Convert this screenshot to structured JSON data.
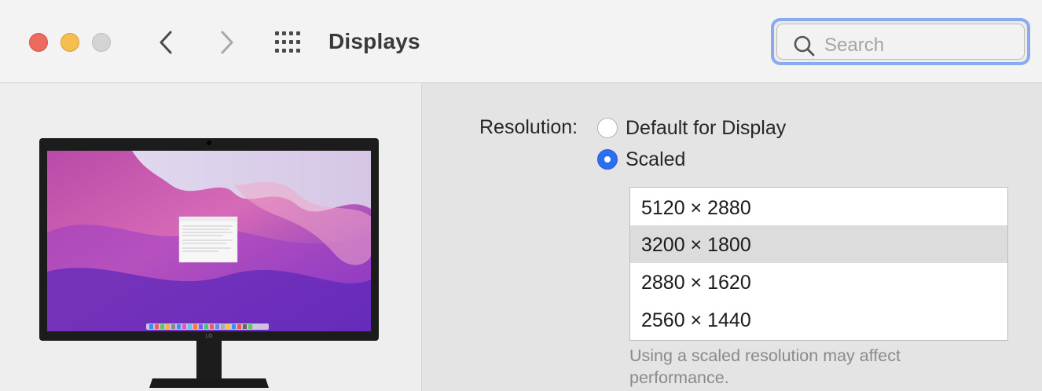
{
  "window": {
    "title": "Displays",
    "search_placeholder": "Search"
  },
  "icons": {
    "back": "chevron-left-icon",
    "forward": "chevron-right-icon",
    "show_all": "grid-icon",
    "search": "magnifying-glass-icon"
  },
  "colors": {
    "close": "#ec6a5e",
    "minimize": "#f4bf4f",
    "zoom": "#d4d4d4",
    "accent": "#2a6ff2",
    "search_focus": "#8ba9ee"
  },
  "display": {
    "resolution_label": "Resolution:",
    "options": [
      {
        "label": "Default for Display",
        "selected": false
      },
      {
        "label": "Scaled",
        "selected": true
      }
    ],
    "scaled_resolutions": [
      {
        "label": "5120 × 2880",
        "selected": false
      },
      {
        "label": "3200 × 1800",
        "selected": true
      },
      {
        "label": "2880 × 1620",
        "selected": false
      },
      {
        "label": "2560 × 1440",
        "selected": false
      }
    ],
    "note": "Using a scaled resolution may affect performance."
  },
  "monitor": {
    "brand": "LG"
  }
}
